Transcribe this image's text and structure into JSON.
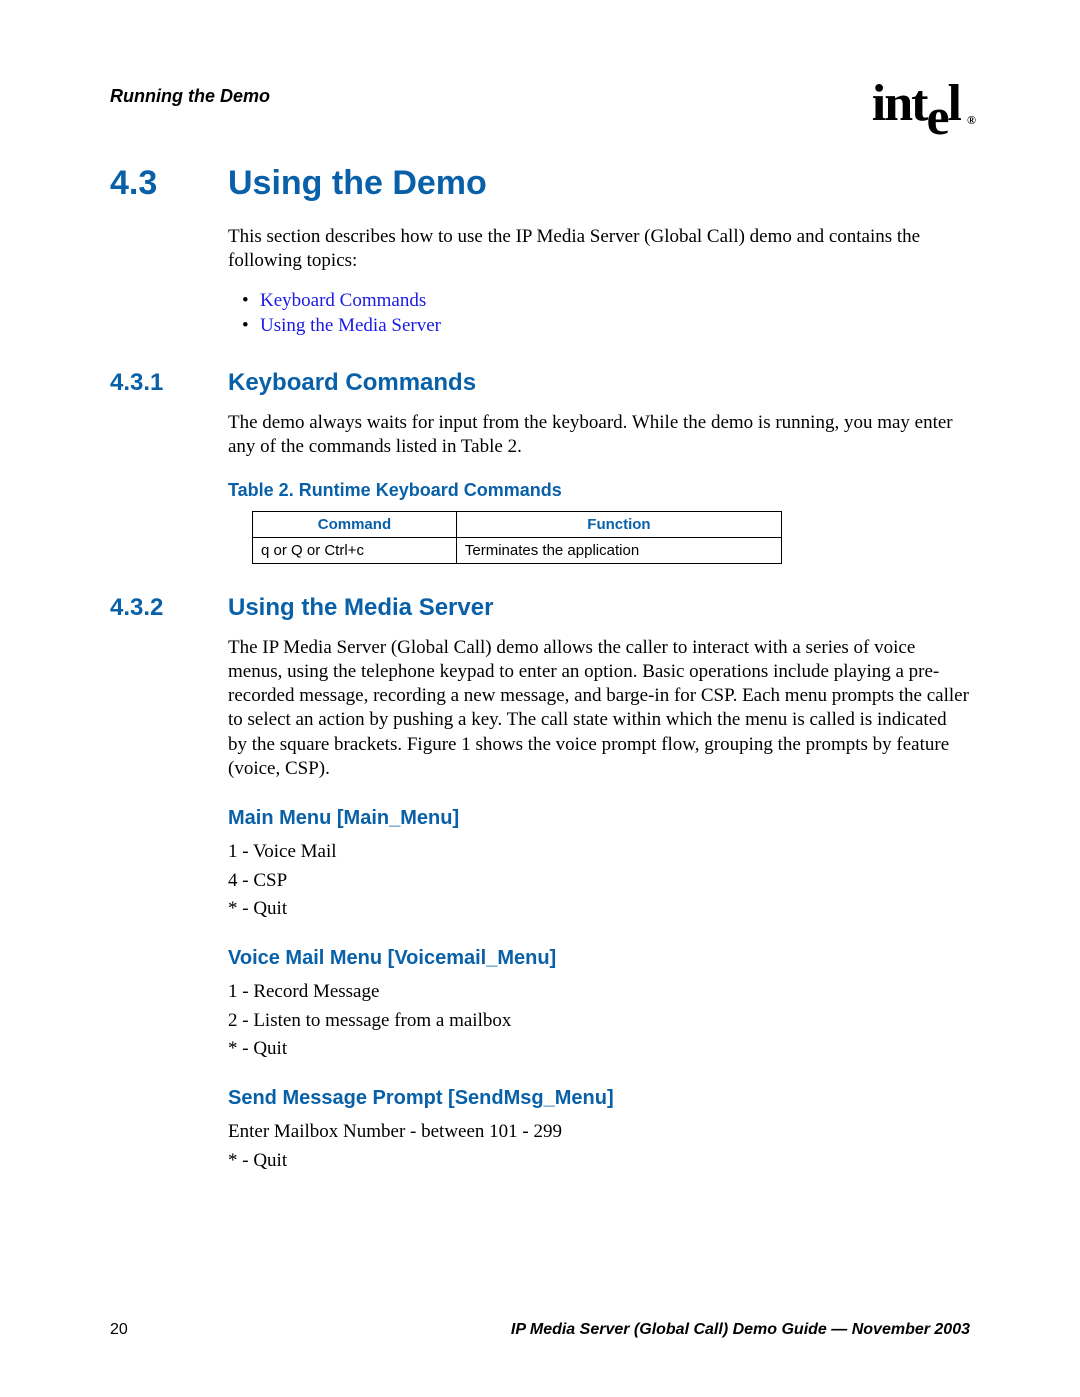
{
  "header": {
    "running_title": "Running the Demo",
    "logo_text": "intel",
    "logo_reg": "®"
  },
  "section": {
    "num": "4.3",
    "title": "Using the Demo",
    "intro": "This section describes how to use the IP Media Server (Global Call) demo and contains the following topics:",
    "bullets": [
      "Keyboard Commands",
      "Using the Media Server"
    ]
  },
  "sub1": {
    "num": "4.3.1",
    "title": "Keyboard Commands",
    "para": "The demo always waits for input from the keyboard. While the demo is running, you may enter any of the commands listed in Table 2.",
    "table_caption": "Table 2.  Runtime Keyboard Commands",
    "table": {
      "head": [
        "Command",
        "Function"
      ],
      "row": [
        "q or Q or Ctrl+c",
        "Terminates the application"
      ]
    }
  },
  "sub2": {
    "num": "4.3.2",
    "title": "Using the Media Server",
    "para": "The IP Media Server (Global Call) demo allows the caller to interact with a series of voice menus, using the telephone keypad to enter an option. Basic operations include playing a pre-recorded message, recording a new message, and barge-in for CSP. Each menu prompts the caller to select an action by pushing a key. The call state within which the menu is called is indicated by the square brackets. Figure 1 shows the voice prompt flow, grouping the prompts by feature (voice, CSP).",
    "menus": [
      {
        "title": "Main Menu [Main_Menu]",
        "items": [
          "1 - Voice Mail",
          "4 - CSP",
          "* - Quit"
        ]
      },
      {
        "title": "Voice Mail Menu [Voicemail_Menu]",
        "items": [
          "1 - Record Message",
          "2 - Listen to message from a mailbox",
          "* - Quit"
        ]
      },
      {
        "title": "Send Message Prompt [SendMsg_Menu]",
        "items": [
          "Enter Mailbox Number - between 101 - 299",
          "* - Quit"
        ]
      }
    ]
  },
  "footer": {
    "page_number": "20",
    "doc_title": "IP Media Server (Global Call) Demo Guide — November 2003"
  }
}
